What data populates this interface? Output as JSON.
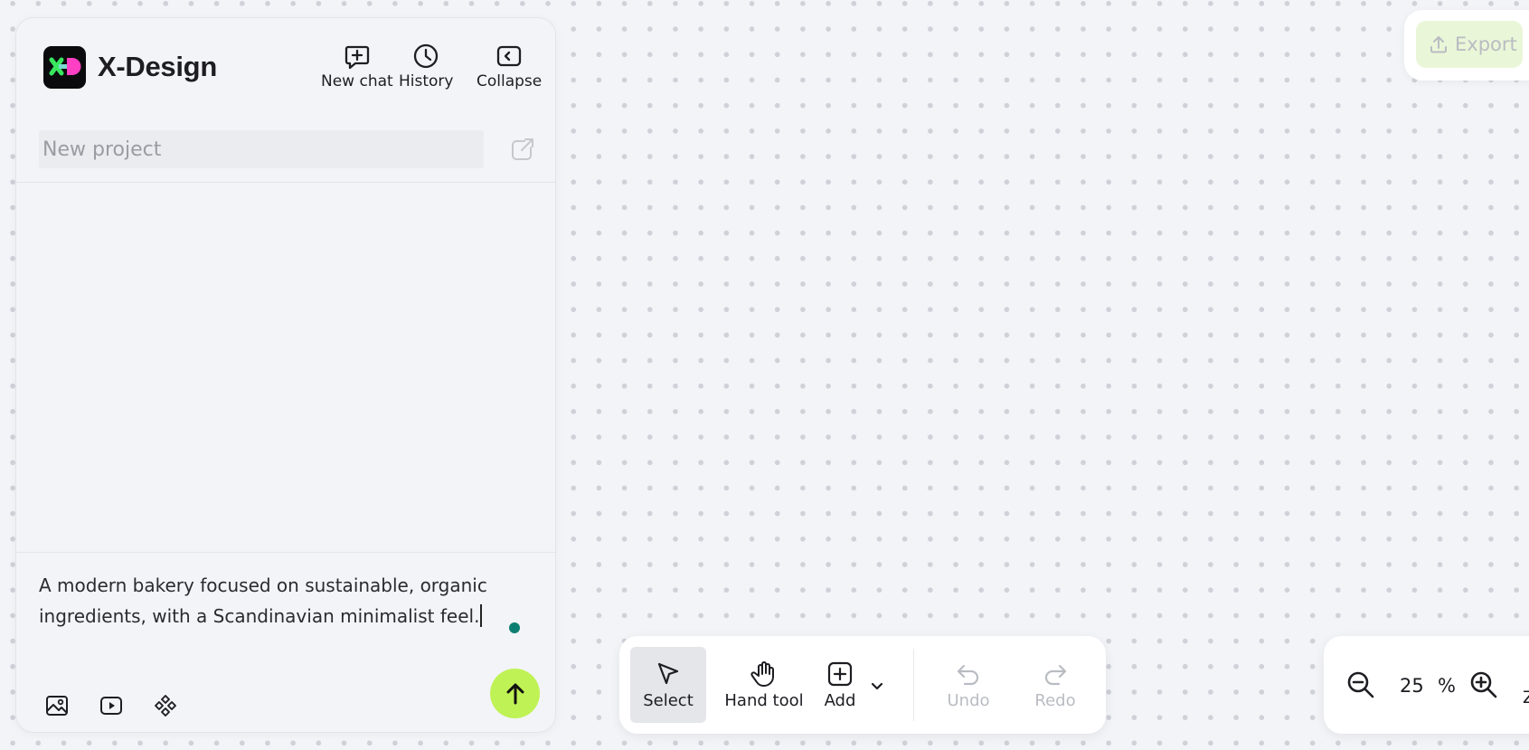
{
  "app": {
    "brand": "X-Design",
    "colors": {
      "accent": "#bff255",
      "status_dot": "#0d7f72",
      "logo_bg": "#0b0b0d",
      "logo_green": "#39e65f",
      "logo_pink": "#ff3fc4"
    }
  },
  "header": {
    "new_chat": "New chat",
    "history": "History",
    "collapse": "Collapse"
  },
  "project": {
    "placeholder": "New project",
    "value": ""
  },
  "prompt": {
    "text": "A modern bakery focused on sustainable, organic ingredients, with a Scandinavian minimalist feel."
  },
  "composer_tools": [
    "image-icon",
    "video-icon",
    "components-icon"
  ],
  "export": {
    "label": "Export"
  },
  "toolbar": {
    "select": "Select",
    "hand": "Hand tool",
    "add": "Add",
    "undo": "Undo",
    "redo": "Redo"
  },
  "zoom": {
    "value": "25",
    "unit": "%",
    "truncated_label": "Z"
  }
}
